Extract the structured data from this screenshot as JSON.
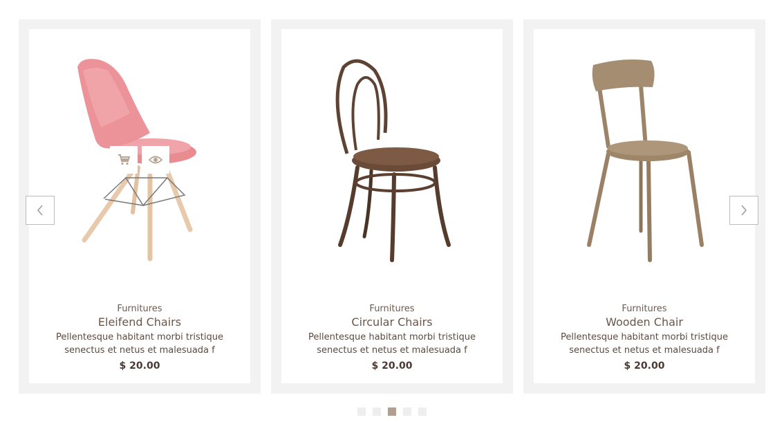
{
  "carousel": {
    "products": [
      {
        "category": "Furnitures",
        "name": "Eleifend Chairs",
        "description": "Pellentesque habitant morbi tristique senectus et netus et malesuada f",
        "price": "$ 20.00",
        "image": "pink-chair-image"
      },
      {
        "category": "Furnitures",
        "name": "Circular Chairs",
        "description": "Pellentesque habitant morbi tristique senectus et netus et malesuada f",
        "price": "$ 20.00",
        "image": "bentwood-chair-image"
      },
      {
        "category": "Furnitures",
        "name": "Wooden Chair",
        "description": "Pellentesque habitant morbi tristique senectus et netus et malesuada f",
        "price": "$ 20.00",
        "image": "wooden-chair-image"
      }
    ],
    "quick_actions": {
      "cart_icon": "cart-icon",
      "view_icon": "eye-icon"
    },
    "nav": {
      "prev_icon": "chevron-left-icon",
      "next_icon": "chevron-right-icon"
    },
    "pagination": {
      "total": 5,
      "active_index": 2
    }
  },
  "colors": {
    "card_background": "#f2f2f2",
    "accent": "#b29f8d",
    "text_brown": "#6a554b",
    "icon_tan": "#b8a48f"
  }
}
